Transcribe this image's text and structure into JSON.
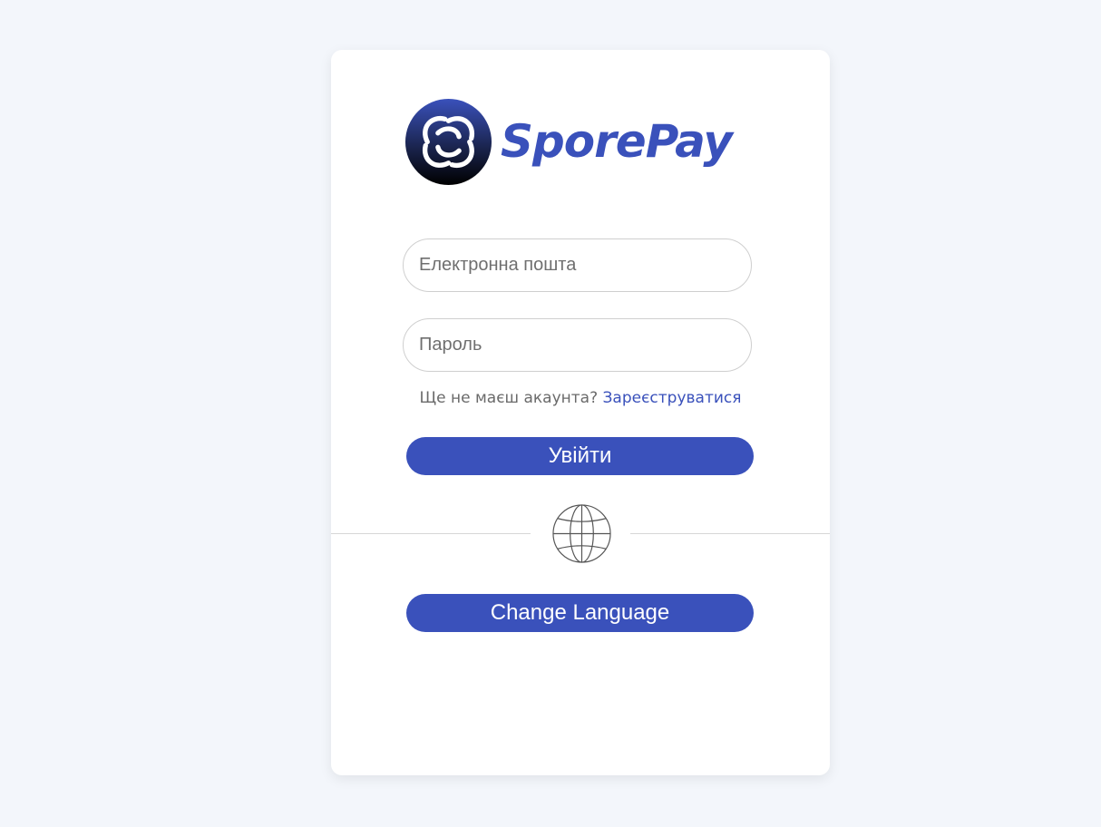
{
  "brand": {
    "name": "SporePay",
    "primary_color": "#3a51bb",
    "logo_icon": "sporepay-swirl-logo-icon"
  },
  "login_form": {
    "email_placeholder": "Електронна пошта",
    "password_placeholder": "Пароль",
    "signup_prompt": "Ще не маєш акаунта?",
    "signup_link": "Зареєструватися",
    "login_button": "Увійти"
  },
  "language": {
    "icon": "globe-icon",
    "button_label": "Change Language"
  },
  "colors": {
    "background": "#f3f6fb",
    "card": "#ffffff",
    "accent": "#3a51bb"
  }
}
